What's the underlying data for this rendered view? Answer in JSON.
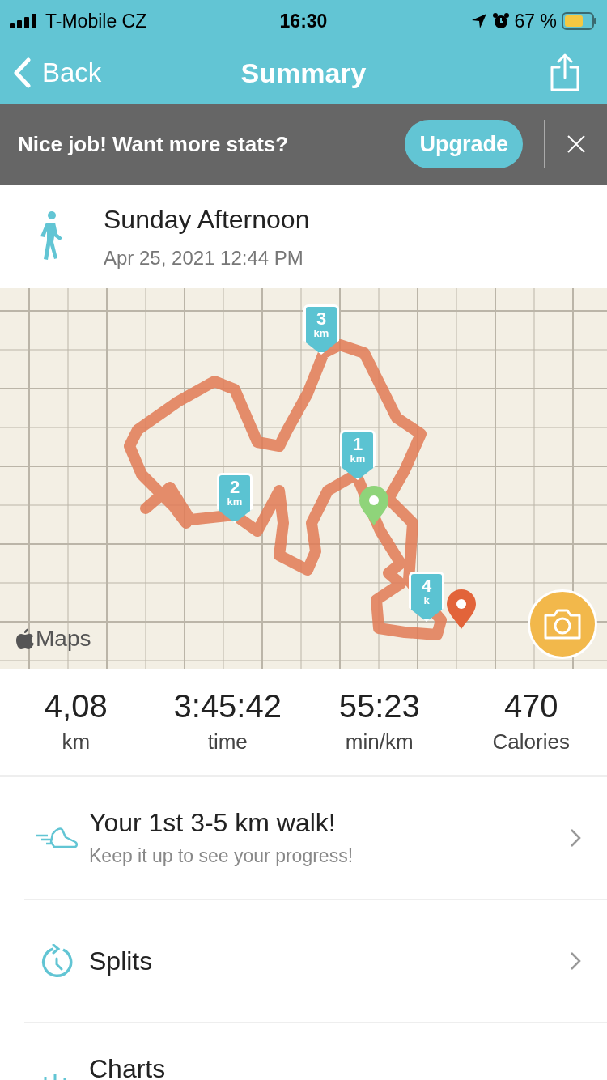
{
  "status_bar": {
    "carrier": "T-Mobile CZ",
    "time": "16:30",
    "battery": "67 %"
  },
  "nav": {
    "back": "Back",
    "title": "Summary"
  },
  "banner": {
    "text": "Nice job! Want more stats?",
    "button": "Upgrade"
  },
  "activity": {
    "title": "Sunday Afternoon",
    "date": "Apr 25, 2021 12:44 PM"
  },
  "map": {
    "attribution": "Maps",
    "markers": [
      {
        "number": "1",
        "unit": "km"
      },
      {
        "number": "2",
        "unit": "km"
      },
      {
        "number": "3",
        "unit": "km"
      },
      {
        "number": "4",
        "unit": "k"
      }
    ]
  },
  "stats": [
    {
      "value": "4,08",
      "label": "km"
    },
    {
      "value": "3:45:42",
      "label": "time"
    },
    {
      "value": "55:23",
      "label": "min/km"
    },
    {
      "value": "470",
      "label": "Calories"
    }
  ],
  "rows": [
    {
      "kind": "achievement",
      "title": "Your 1st 3-5 km walk!",
      "subtitle": "Keep it up to see your progress!"
    },
    {
      "kind": "splits",
      "title": "Splits"
    },
    {
      "kind": "charts",
      "title": "Charts"
    }
  ]
}
